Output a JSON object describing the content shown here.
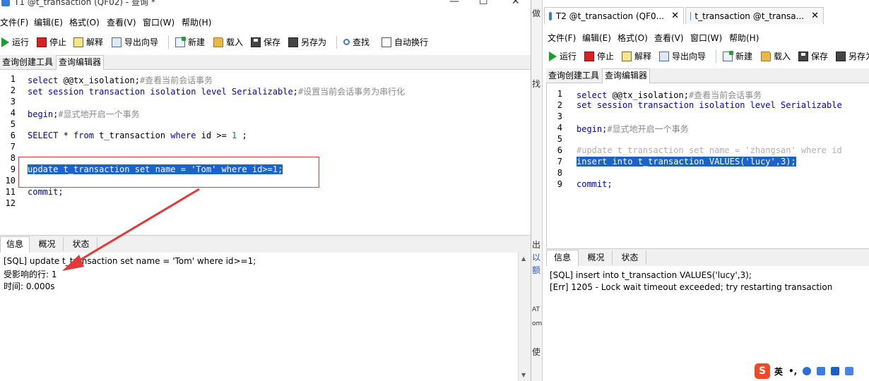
{
  "left": {
    "title": "T1 @t_transaction (QF02) - 查询 *",
    "menu": [
      "文件(F)",
      "编辑(E)",
      "格式(O)",
      "查看(V)",
      "窗口(W)",
      "帮助(H)"
    ],
    "toolbar": {
      "run": "运行",
      "stop": "停止",
      "explain": "解释",
      "export": "导出向导",
      "new": "新建",
      "load": "载入",
      "save": "保存",
      "saveas": "另存为",
      "find": "查找",
      "autowrap": "自动换行"
    },
    "tabs": [
      "查询创建工具",
      "查询编辑器"
    ],
    "lines": [
      "1",
      "2",
      "3",
      "4",
      "5",
      "6",
      "7",
      "8",
      "9",
      "10",
      "11",
      "12"
    ],
    "code": {
      "l1_kw": "select",
      "l1_var": " @@tx_isolation;",
      "l1_cm": "#查看当前会话事务",
      "l2_kw": "set session transaction isolation level Serializable;",
      "l2_cm": "#设置当前会话事务为串行化",
      "l4_kw": "begin;",
      "l4_cm": "#显式地开启一个事务",
      "l6_a": "SELECT",
      "l6_b": " * ",
      "l6_c": "from",
      "l6_d": " t_transaction ",
      "l6_e": "where",
      "l6_f": " id >= ",
      "l6_g": "1",
      "l6_h": " ;",
      "l9": "update t_transaction set name = 'Tom' where id>=1;",
      "l11": "commit;"
    },
    "bottom_tabs": [
      "信息",
      "概况",
      "状态"
    ],
    "messages": [
      "[SQL] update t_transaction set name = 'Tom' where id>=1;",
      "受影响的行: 1",
      "时间: 0.000s"
    ]
  },
  "gap": {
    "chars": [
      "做",
      "找",
      "出",
      "以",
      "额",
      "AT",
      "om",
      "使"
    ]
  },
  "right": {
    "doc_tabs": [
      "T2 @t_transaction (QF0...",
      "t_transaction @t_transa..."
    ],
    "menu": [
      "文件(F)",
      "编辑(E)",
      "格式(O)",
      "查看(V)",
      "窗口(W)",
      "帮助(H)"
    ],
    "toolbar": {
      "run": "运行",
      "stop": "停止",
      "explain": "解释",
      "export": "导出向导",
      "new": "新建",
      "load": "载入",
      "save": "保存",
      "saveas": "另存为"
    },
    "tabs": [
      "查询创建工具",
      "查询编辑器"
    ],
    "lines": [
      "1",
      "2",
      "3",
      "4",
      "5",
      "6",
      "7",
      "8",
      "9"
    ],
    "code": {
      "l1_kw": "select",
      "l1_var": " @@tx_isolation;",
      "l1_cm": "#查看当前会话事务",
      "l2_kw": "set session transaction isolation level Serializable",
      "l4_kw": "begin;",
      "l4_cm": "#显式地开启一个事务",
      "l6": "#update t_transaction set name = 'zhangsan' where id",
      "l7": "insert into t_transaction VALUES('lucy',3);",
      "l9": "commit;"
    },
    "bottom_tabs": [
      "信息",
      "概况",
      "状态"
    ],
    "messages": [
      "[SQL] insert into t_transaction VALUES('lucy',3);",
      "[Err] 1205 - Lock wait timeout exceeded; try restarting transaction"
    ]
  },
  "ime": {
    "logo": "S",
    "mode": "英"
  },
  "colors": {
    "keyword": "#0000cc",
    "comment": "#8a8a8a",
    "selection": "#1a63c8",
    "annotation": "#e23a3a"
  }
}
